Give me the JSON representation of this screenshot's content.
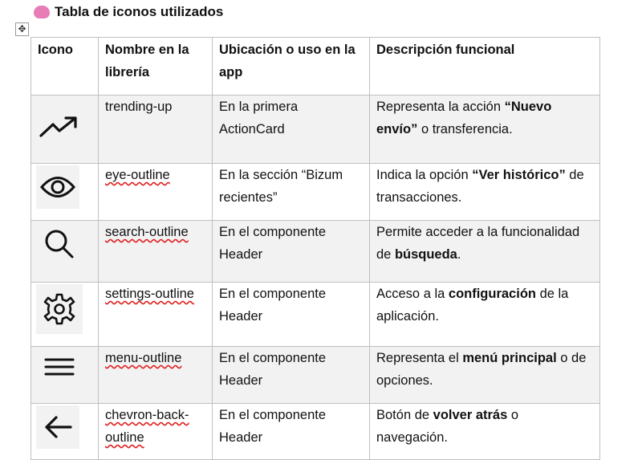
{
  "title": "Tabla de iconos utilizados",
  "title_icon": "brain-emoji",
  "headers": [
    "Icono",
    "Nombre en la librería",
    "Ubicación o uso en la app",
    "Descripción funcional"
  ],
  "rows": [
    {
      "icon": "trending-up",
      "name": "trending-up",
      "location": "En la primera ActionCard",
      "desc_pre": "Representa la acción ",
      "desc_bold": "“Nuevo envío”",
      "desc_post": " o transferencia."
    },
    {
      "icon": "eye-outline",
      "name": "eye-outline",
      "location": "En la sección “Bizum recientes”",
      "desc_pre": "Indica la opción ",
      "desc_bold": "“Ver histórico”",
      "desc_post": " de transacciones."
    },
    {
      "icon": "search-outline",
      "name": "search-outline",
      "location": "En el componente Header",
      "desc_pre": "Permite acceder a la funcionalidad de ",
      "desc_bold": "búsqueda",
      "desc_post": "."
    },
    {
      "icon": "settings-outline",
      "name": "settings-outline",
      "location": "En el componente Header",
      "desc_pre": "Acceso a la ",
      "desc_bold": "configuración",
      "desc_post": " de la aplicación."
    },
    {
      "icon": "menu-outline",
      "name": "menu-outline",
      "location": "En el componente Header",
      "desc_pre": "Representa el ",
      "desc_bold": "menú principal",
      "desc_post": " o de opciones."
    },
    {
      "icon": "chevron-back-outline",
      "name": "chevron-back-outline",
      "location": "En el componente Header",
      "desc_pre": "Botón de ",
      "desc_bold": "volver atrás",
      "desc_post": " o navegación."
    }
  ]
}
